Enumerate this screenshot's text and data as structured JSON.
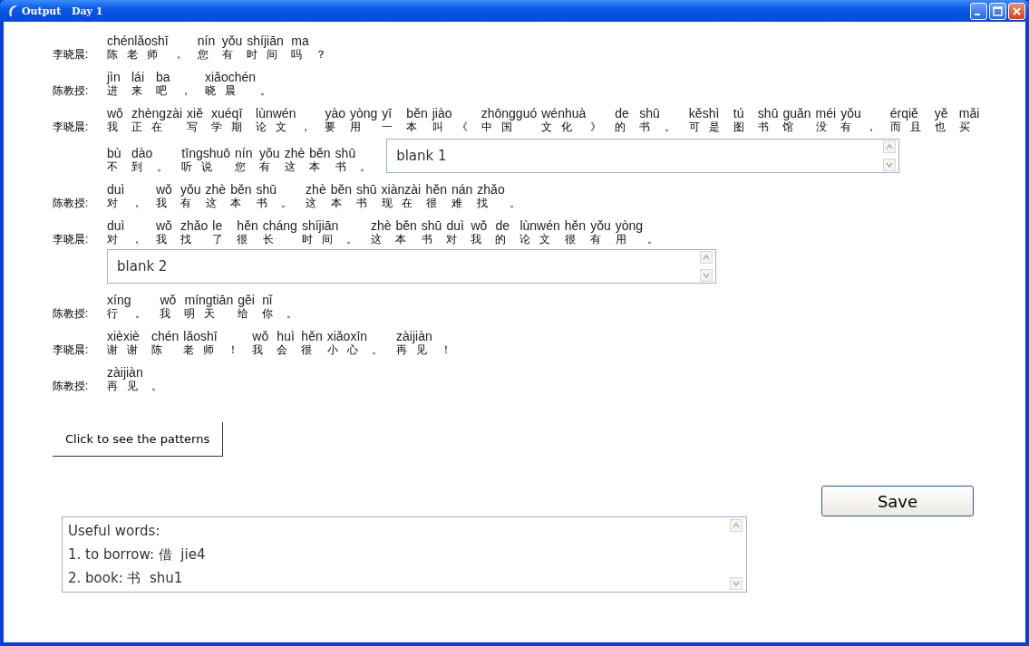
{
  "window": {
    "title": "Output   Day 1"
  },
  "dialogue": [
    {
      "speaker": "李晓晨:",
      "tokens": [
        [
          "chénlǎoshī",
          "陈老师"
        ],
        [
          "，"
        ],
        [
          "nín",
          "您"
        ],
        [
          "yǒu",
          "有"
        ],
        [
          "shíjiān",
          "时间"
        ],
        [
          "ma",
          "吗"
        ],
        [
          "？"
        ]
      ]
    },
    {
      "speaker": "陈教授:",
      "tokens": [
        [
          "jìn",
          "进"
        ],
        [
          "lái",
          "来"
        ],
        [
          "ba",
          "吧"
        ],
        [
          "，"
        ],
        [
          "xiǎochén",
          "晓晨"
        ],
        [
          "。"
        ]
      ]
    },
    {
      "speaker": "李晓晨:",
      "tokens": [
        [
          "wǒ",
          "我"
        ],
        [
          "zhèngzài",
          "正在"
        ],
        [
          "xiě",
          "写"
        ],
        [
          "xuéqī",
          "学期"
        ],
        [
          "lùnwén",
          "论文"
        ],
        [
          "，"
        ],
        [
          "yào",
          "要"
        ],
        [
          "yòng",
          "用"
        ],
        [
          "yī",
          "一"
        ],
        [
          "běn",
          "本"
        ],
        [
          "jiào",
          "叫"
        ],
        [
          "《"
        ],
        [
          "zhōngguó",
          "中国"
        ],
        [
          "wénhuà",
          "文化"
        ],
        [
          "》"
        ],
        [
          "de",
          "的"
        ],
        [
          "shū",
          "书"
        ],
        [
          "。"
        ],
        [
          "kěshì",
          "可是"
        ],
        [
          "tú",
          "图"
        ],
        [
          "shū",
          "书"
        ],
        [
          "guǎn",
          "馆"
        ],
        [
          "méi",
          "没"
        ],
        [
          "yǒu",
          "有"
        ],
        [
          "，"
        ],
        [
          "érqiě",
          "而且"
        ],
        [
          "yě",
          "也"
        ],
        [
          "mǎi",
          "买"
        ]
      ],
      "wrapped_tokens": [
        [
          "bù",
          "不"
        ],
        [
          "dào",
          "到"
        ],
        [
          "。"
        ],
        [
          "tīngshuō",
          "听说"
        ],
        [
          "nín",
          "您"
        ],
        [
          "yǒu",
          "有"
        ],
        [
          "zhè",
          "这"
        ],
        [
          "běn",
          "本"
        ],
        [
          "shū",
          "书"
        ],
        [
          "。"
        ]
      ],
      "inline_blank": {
        "value": "blank 1"
      }
    },
    {
      "speaker": "陈教授:",
      "tokens": [
        [
          "duì",
          "对"
        ],
        [
          "，"
        ],
        [
          "wǒ",
          "我"
        ],
        [
          "yǒu",
          "有"
        ],
        [
          "zhè",
          "这"
        ],
        [
          "běn",
          "本"
        ],
        [
          "shū",
          "书"
        ],
        [
          "。"
        ],
        [
          "zhè",
          "这"
        ],
        [
          "běn",
          "本"
        ],
        [
          "shū",
          "书"
        ],
        [
          "xiànzài",
          "现在"
        ],
        [
          "hěn",
          "很"
        ],
        [
          "nán",
          "难"
        ],
        [
          "zhǎo",
          "找"
        ],
        [
          "。"
        ]
      ]
    },
    {
      "speaker": "李晓晨:",
      "tokens": [
        [
          "duì",
          "对"
        ],
        [
          "，"
        ],
        [
          "wǒ",
          "我"
        ],
        [
          "zhǎo",
          "找"
        ],
        [
          "le",
          "了"
        ],
        [
          "hěn",
          "很"
        ],
        [
          "cháng",
          "长"
        ],
        [
          "shíjiān",
          "时间"
        ],
        [
          "。"
        ],
        [
          "zhè",
          "这"
        ],
        [
          "běn",
          "本"
        ],
        [
          "shū",
          "书"
        ],
        [
          "duì",
          "对"
        ],
        [
          "wǒ",
          "我"
        ],
        [
          "de",
          "的"
        ],
        [
          "lùnwén",
          "论文"
        ],
        [
          "hěn",
          "很"
        ],
        [
          "yǒu",
          "有"
        ],
        [
          "yòng",
          "用"
        ],
        [
          "。"
        ]
      ],
      "blank": {
        "value": "blank 2"
      }
    },
    {
      "speaker": "陈教授:",
      "tokens": [
        [
          "xíng",
          "行"
        ],
        [
          "。"
        ],
        [
          "wǒ",
          "我"
        ],
        [
          "míngtiān",
          "明天"
        ],
        [
          "gěi",
          "给"
        ],
        [
          "nǐ",
          "你"
        ],
        [
          "。"
        ]
      ]
    },
    {
      "speaker": "李晓晨:",
      "tokens": [
        [
          "xièxiè",
          "谢谢"
        ],
        [
          "chén",
          "陈"
        ],
        [
          "lǎoshī",
          "老师"
        ],
        [
          "！"
        ],
        [
          "wǒ",
          "我"
        ],
        [
          "huì",
          "会"
        ],
        [
          "hěn",
          "很"
        ],
        [
          "xiǎoxīn",
          "小心"
        ],
        [
          "。"
        ],
        [
          "zàijiàn",
          "再见"
        ],
        [
          "！"
        ]
      ]
    },
    {
      "speaker": "陈教授:",
      "tokens": [
        [
          "zàijiàn",
          "再见"
        ],
        [
          "。"
        ]
      ]
    }
  ],
  "patterns_button": "Click to see the patterns",
  "save_button": "Save",
  "useful_words": [
    "Useful words:",
    "1. to borrow: 借  jie4",
    "2. book: 书  shu1"
  ]
}
